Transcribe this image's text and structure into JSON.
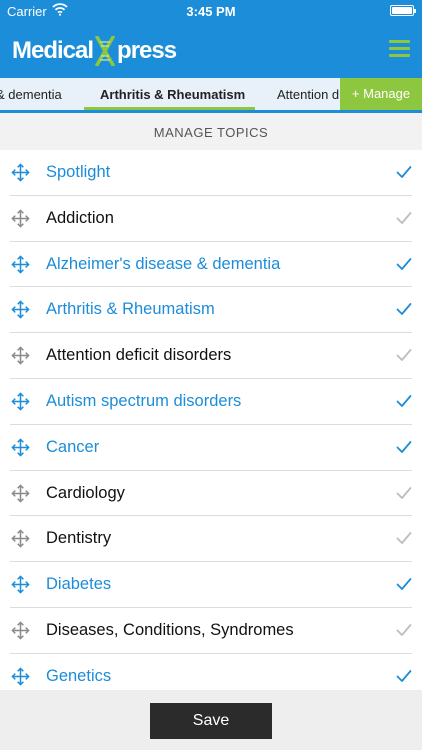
{
  "status_bar": {
    "carrier": "Carrier",
    "time": "3:45 PM"
  },
  "header": {
    "logo_part1": "Medical",
    "logo_part2": "press",
    "menu_icon": "hamburger-menu-icon"
  },
  "tabs": [
    {
      "label": "& dementia"
    },
    {
      "label": "Arthritis & Rheumatism",
      "active": true
    },
    {
      "label": "Attention d"
    }
  ],
  "manage_button": {
    "label": "+ Manage"
  },
  "section_title": "MANAGE TOPICS",
  "topics": [
    {
      "label": "Spotlight",
      "selected": true
    },
    {
      "label": "Addiction",
      "selected": false
    },
    {
      "label": "Alzheimer's disease & dementia",
      "selected": true
    },
    {
      "label": "Arthritis & Rheumatism",
      "selected": true
    },
    {
      "label": "Attention deficit disorders",
      "selected": false
    },
    {
      "label": "Autism spectrum disorders",
      "selected": true
    },
    {
      "label": "Cancer",
      "selected": true
    },
    {
      "label": "Cardiology",
      "selected": false
    },
    {
      "label": "Dentistry",
      "selected": false
    },
    {
      "label": "Diabetes",
      "selected": true
    },
    {
      "label": "Diseases, Conditions, Syndromes",
      "selected": false
    },
    {
      "label": "Genetics",
      "selected": true
    }
  ],
  "save_button": {
    "label": "Save"
  },
  "colors": {
    "primary_blue": "#1c8dd8",
    "accent_green": "#8dc63f",
    "unselected_gray": "#bdbdbd",
    "dark_button": "#2b2b2b"
  }
}
